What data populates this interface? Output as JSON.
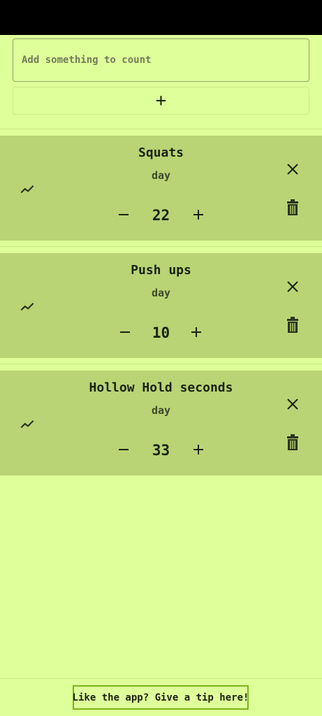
{
  "add_form": {
    "placeholder": "Add something to count",
    "add_button_label": "+"
  },
  "counters": [
    {
      "title": "Squats",
      "period": "day",
      "count": "22"
    },
    {
      "title": "Push ups",
      "period": "day",
      "count": "10"
    },
    {
      "title": "Hollow Hold seconds",
      "period": "day",
      "count": "33"
    }
  ],
  "icons": {
    "chart": "trending-up-icon",
    "close": "close-icon",
    "delete": "trash-icon",
    "minus": "minus-icon",
    "plus": "plus-icon"
  },
  "colors": {
    "background": "#DFFF9A",
    "card": "#B9D474",
    "text": "#1A2310",
    "tip_border": "#79B51A"
  },
  "footer": {
    "tip_label": "Like the app? Give a tip here!"
  }
}
